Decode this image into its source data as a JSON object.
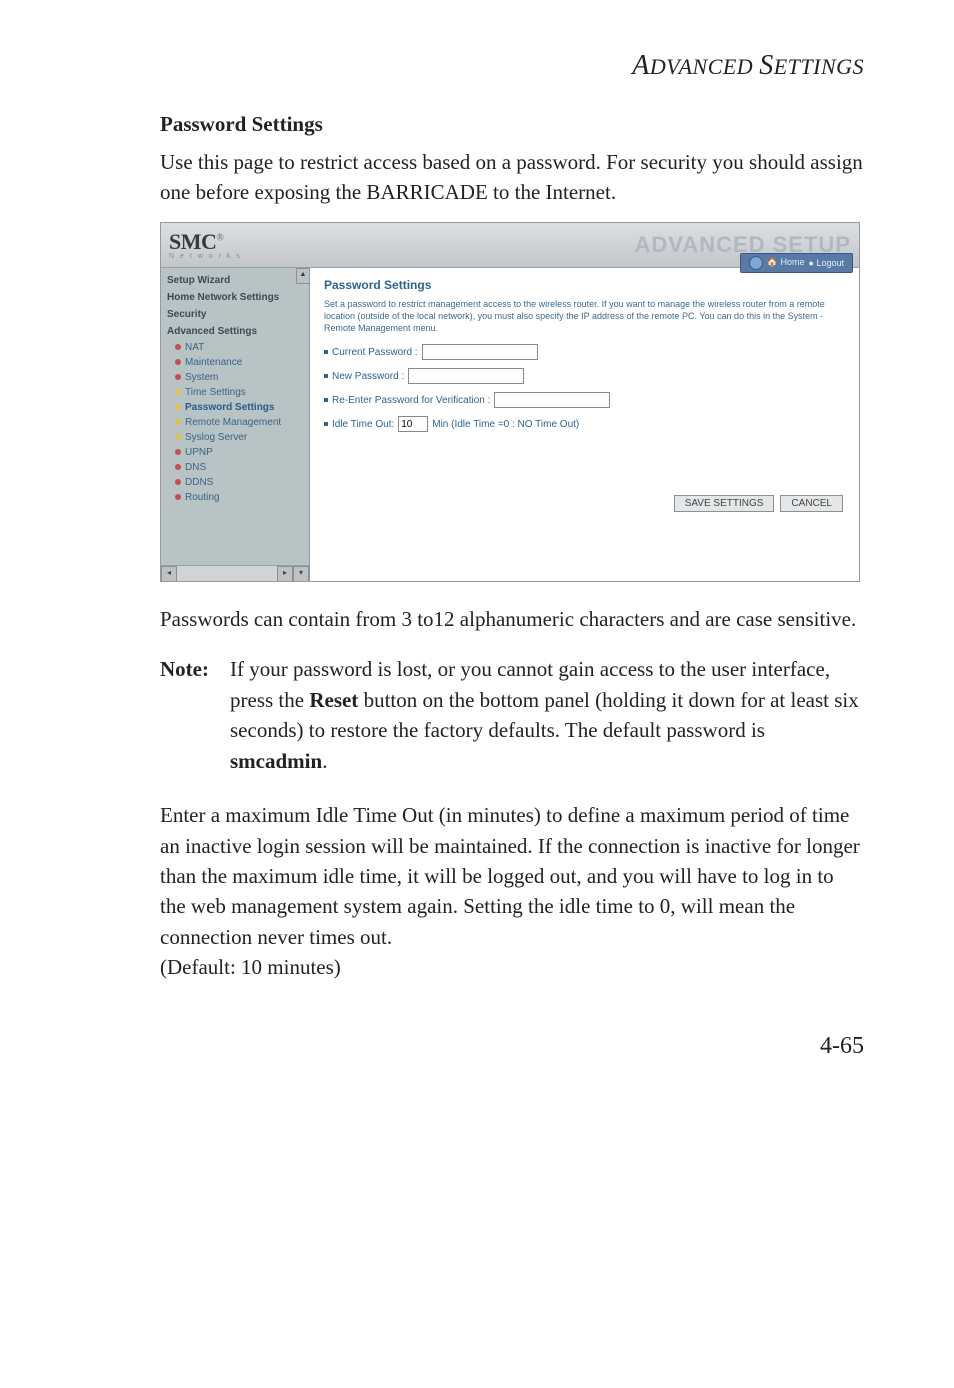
{
  "running_head": "ADVANCED SETTINGS",
  "section_title": "Password Settings",
  "intro": "Use this page to restrict access based on a password. For security you should assign one before exposing the BARRICADE to the Internet.",
  "after_img": "Passwords can contain from 3 to12 alphanumeric characters and are case sensitive.",
  "note_label": "Note:",
  "note_text_pre": "If your password is lost, or you cannot gain access to the user interface, press the ",
  "note_reset": "Reset",
  "note_text_mid": " button on the bottom panel (holding it down for at least six seconds) to restore the factory defaults. The default password is ",
  "note_default_pw": "smcadmin",
  "note_text_end": ".",
  "para2": "Enter a maximum Idle Time Out (in minutes) to define a maximum period of time an inactive login session will be maintained. If the connection is inactive for longer than the maximum idle time, it will be logged out, and you will have to log in to the web management system again. Setting the idle time to 0, will mean the connection never times out.",
  "para2_default": "(Default: 10 minutes)",
  "page_number": "4-65",
  "router": {
    "logo": "SMC",
    "logo_sub": "N e t w o r k s",
    "banner_title": "ADVANCED SETUP",
    "home_label": "Home",
    "logout_label": "Logout",
    "sidebar": {
      "setup_wizard": "Setup Wizard",
      "home_network": "Home Network Settings",
      "security": "Security",
      "advanced": "Advanced Settings",
      "items": [
        "NAT",
        "Maintenance",
        "System",
        "Time Settings",
        "Password Settings",
        "Remote Management",
        "Syslog Server",
        "UPNP",
        "DNS",
        "DDNS",
        "Routing"
      ]
    },
    "content": {
      "heading": "Password Settings",
      "desc": "Set a password to restrict management access to the wireless router. If you want to manage the wireless router from a remote location (outside of the local network), you must also specify the IP address of the remote PC. You can do this in the System - Remote Management menu.",
      "current_pw_label": "Current Password :",
      "new_pw_label": "New Password :",
      "reenter_label": "Re-Enter Password for Verification :",
      "idle_label_pre": "Idle Time Out:",
      "idle_value": "10",
      "idle_label_post": "Min (Idle Time =0 : NO Time Out)",
      "save_btn": "SAVE SETTINGS",
      "cancel_btn": "CANCEL"
    }
  }
}
